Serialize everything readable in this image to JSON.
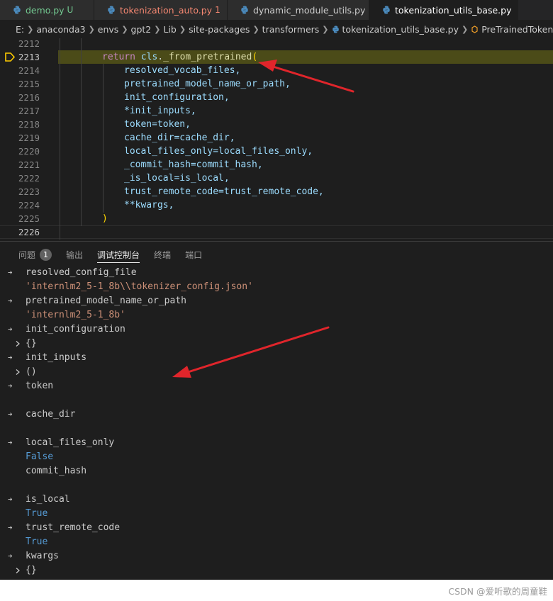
{
  "tabs": [
    {
      "name": "demo.py",
      "suffix": "U"
    },
    {
      "name": "tokenization_auto.py",
      "suffix": "1"
    },
    {
      "name": "dynamic_module_utils.py",
      "suffix": ""
    },
    {
      "name": "tokenization_utils_base.py",
      "suffix": "",
      "close": "✕"
    }
  ],
  "breadcrumb": [
    "E:",
    "anaconda3",
    "envs",
    "gpt2",
    "Lib",
    "site-packages",
    "transformers",
    "tokenization_utils_base.py",
    "PreTrainedTokenizerBase"
  ],
  "editor": {
    "line_numbers": [
      "2212",
      "2213",
      "2214",
      "2215",
      "2216",
      "2217",
      "2218",
      "2219",
      "2220",
      "2221",
      "2222",
      "2223",
      "2224",
      "2225",
      "2226"
    ],
    "line_2213": {
      "keyword": "return",
      "object": "cls",
      "method": "_from_pretrained",
      "open_paren": "("
    },
    "args": [
      "resolved_vocab_files,",
      "pretrained_model_name_or_path,",
      "init_configuration,",
      "*init_inputs,",
      "token=token,",
      "cache_dir=cache_dir,",
      "local_files_only=local_files_only,",
      "_commit_hash=commit_hash,",
      "_is_local=is_local,",
      "trust_remote_code=trust_remote_code,",
      "**kwargs,"
    ],
    "close_paren": ")"
  },
  "panel": {
    "tabs": [
      {
        "label": "问题",
        "badge": "1"
      },
      {
        "label": "输出"
      },
      {
        "label": "调试控制台"
      },
      {
        "label": "终端"
      },
      {
        "label": "端口"
      }
    ],
    "console": [
      {
        "text": "resolved_config_file",
        "kind": "input"
      },
      {
        "text": "'internlm2_5-1_8b\\\\tokenizer_config.json'",
        "kind": "string"
      },
      {
        "text": "pretrained_model_name_or_path",
        "kind": "input"
      },
      {
        "text": "'internlm2_5-1_8b'",
        "kind": "string"
      },
      {
        "text": "init_configuration",
        "kind": "input"
      },
      {
        "text": "{}",
        "kind": "object"
      },
      {
        "text": "init_inputs",
        "kind": "input"
      },
      {
        "text": "()",
        "kind": "object"
      },
      {
        "text": "token",
        "kind": "input"
      },
      {
        "text": "",
        "kind": "empty"
      },
      {
        "text": "cache_dir",
        "kind": "input"
      },
      {
        "text": "",
        "kind": "empty"
      },
      {
        "text": "local_files_only",
        "kind": "input"
      },
      {
        "text": "False",
        "kind": "bool"
      },
      {
        "text": "commit_hash",
        "kind": "input"
      },
      {
        "text": "",
        "kind": "empty"
      },
      {
        "text": "is_local",
        "kind": "input"
      },
      {
        "text": "True",
        "kind": "bool"
      },
      {
        "text": "trust_remote_code",
        "kind": "input"
      },
      {
        "text": "True",
        "kind": "bool"
      },
      {
        "text": "kwargs",
        "kind": "input"
      },
      {
        "text": "{}",
        "kind": "object"
      }
    ]
  },
  "watermark": "CSDN @爱听歌的周童鞋",
  "colors": {
    "arrow": "#e0252b",
    "modified_tab": "#73c991",
    "error_tab": "#f48771",
    "highlight": "#4b4b18"
  }
}
